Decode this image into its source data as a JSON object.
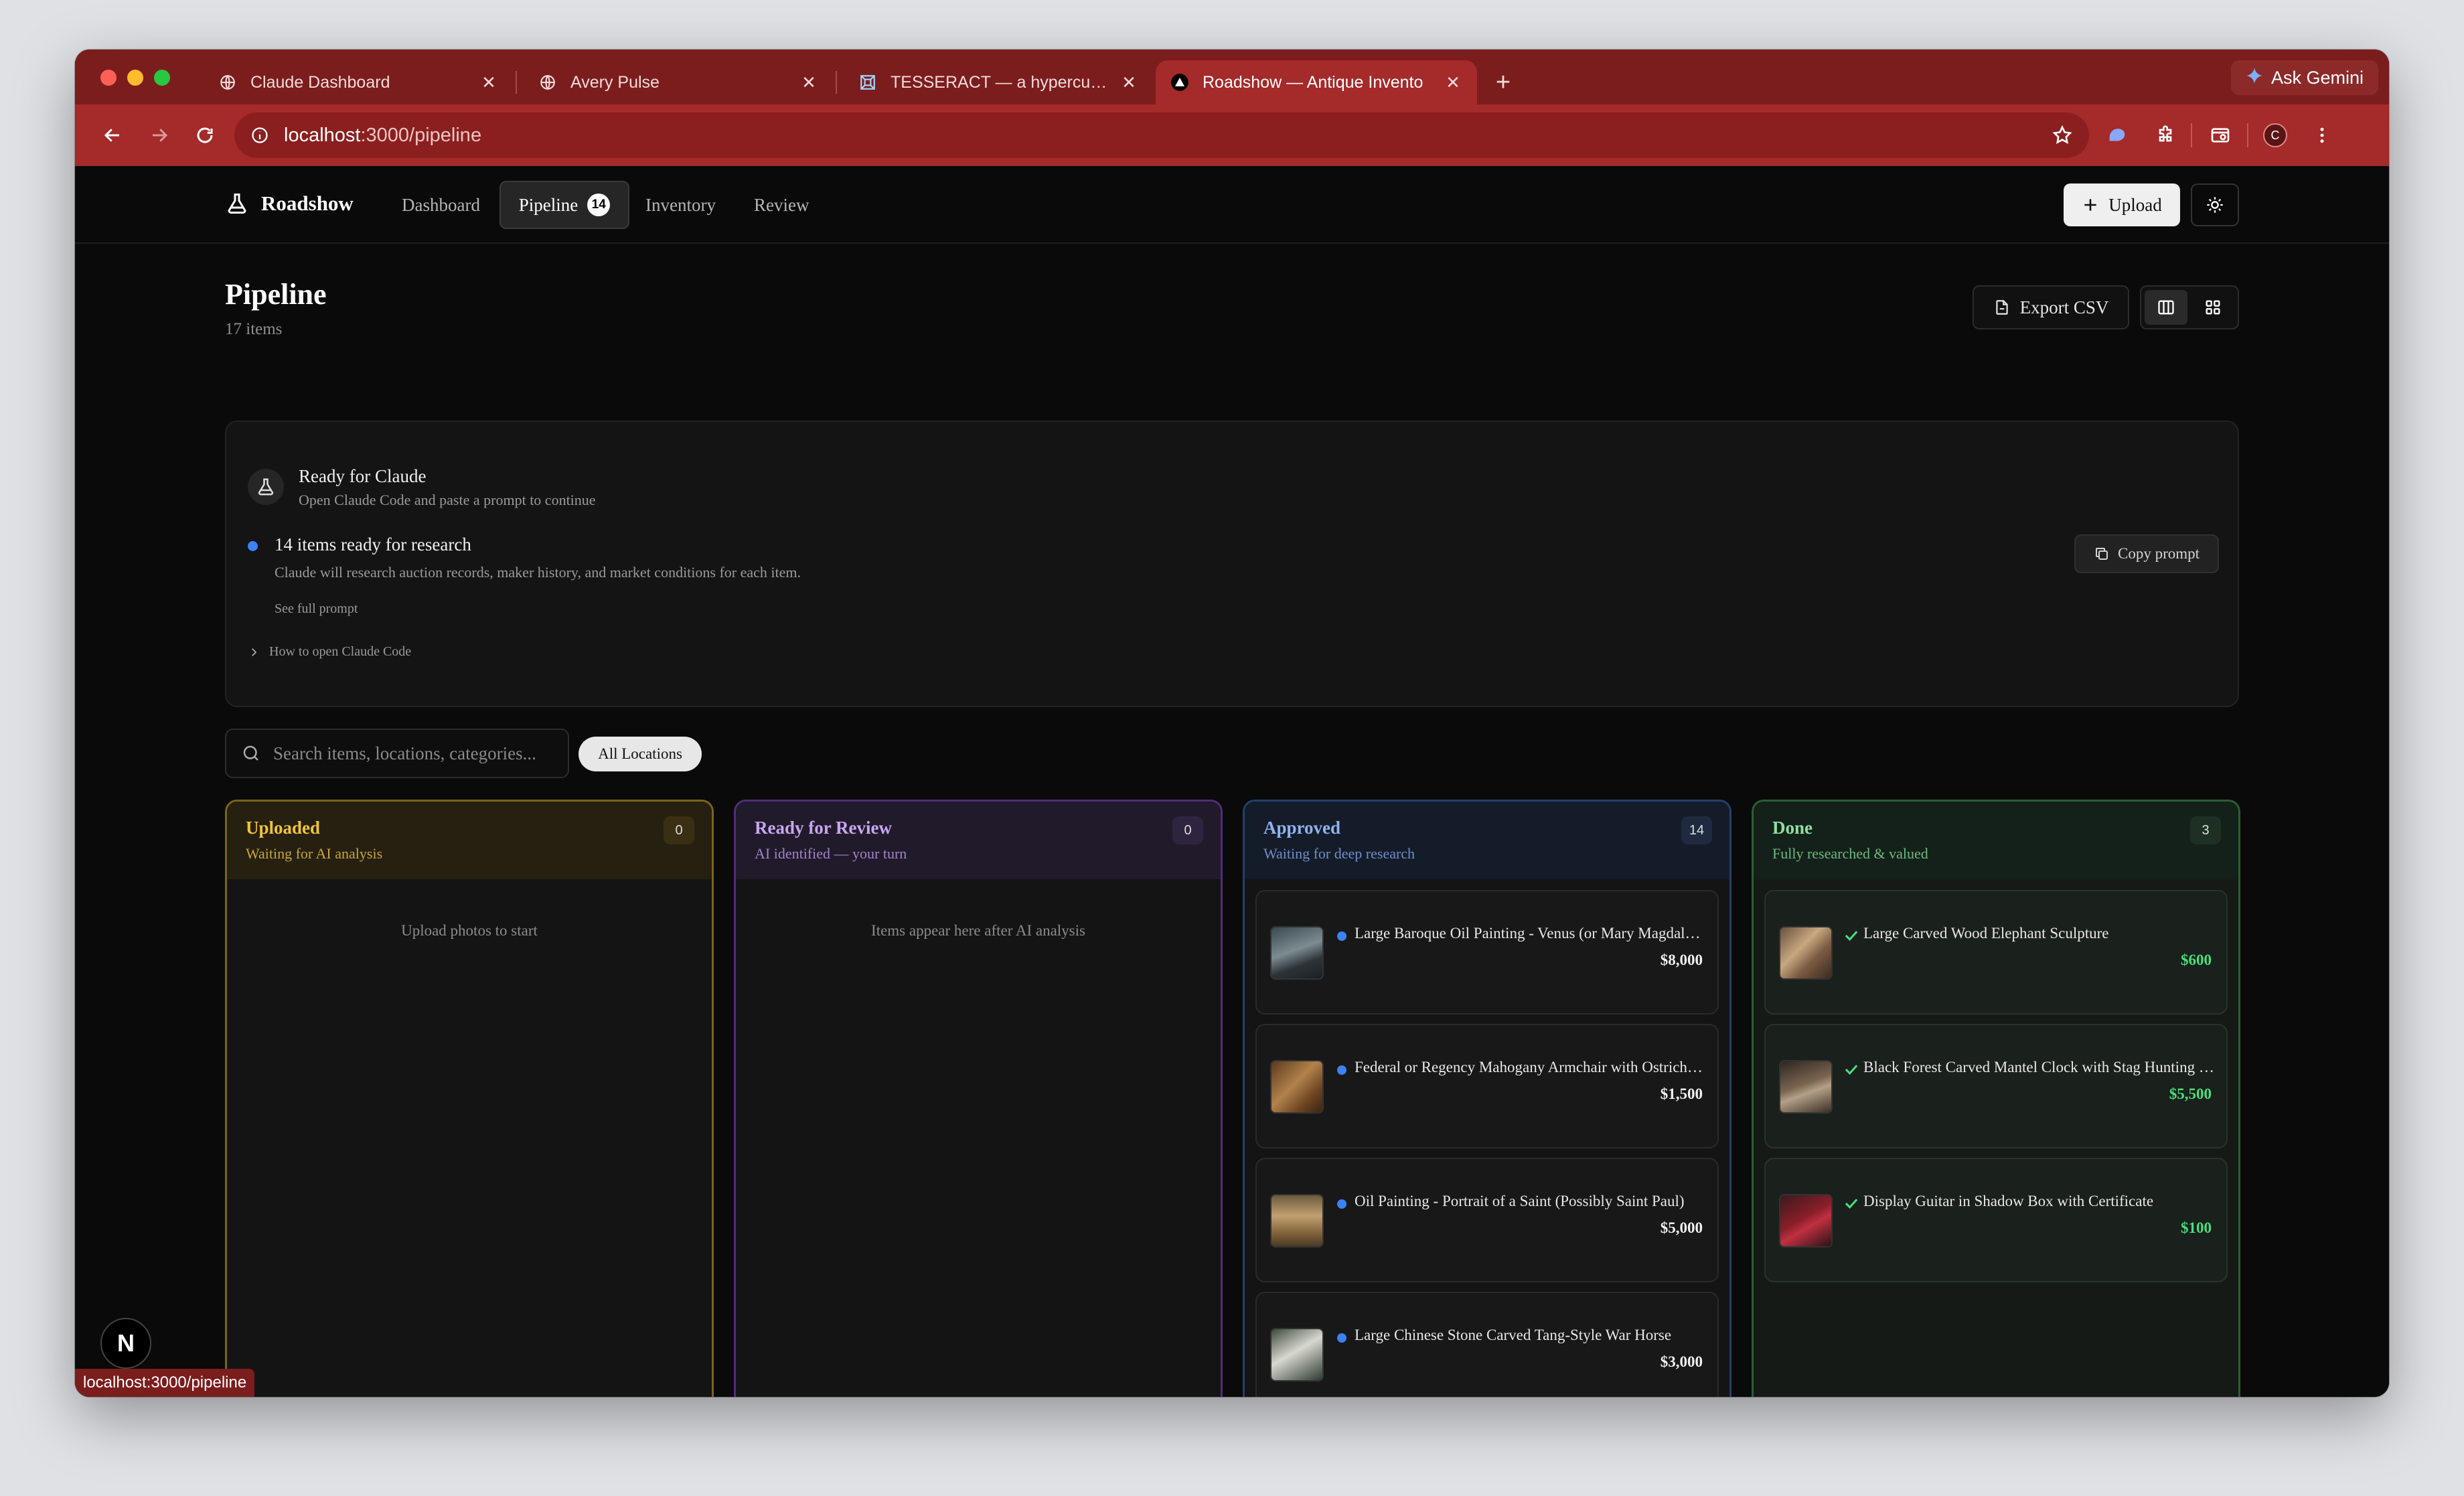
{
  "browser": {
    "tabs": [
      {
        "title": "Claude Dashboard",
        "active": false
      },
      {
        "title": "Avery Pulse",
        "active": false
      },
      {
        "title": "TESSERACT — a hypercube y",
        "active": false
      },
      {
        "title": "Roadshow — Antique Invento",
        "active": true
      }
    ],
    "gemini_label": "Ask Gemini",
    "url_host": "localhost",
    "url_path": ":3000/pipeline",
    "avatar_letter": "C",
    "status_url": "localhost:3000/pipeline",
    "accent": "#a52a2a"
  },
  "app": {
    "brand": "Roadshow",
    "nav": {
      "dashboard": "Dashboard",
      "pipeline": "Pipeline",
      "pipeline_badge": "14",
      "inventory": "Inventory",
      "review": "Review"
    },
    "upload_label": "Upload"
  },
  "page": {
    "title": "Pipeline",
    "count": "17 items",
    "export_label": "Export CSV"
  },
  "claude_card": {
    "title": "Ready for Claude",
    "subtitle": "Open Claude Code and paste a prompt to continue",
    "ready_text": "14 items ready for research",
    "description": "Claude will research auction records, maker history, and market conditions for each item.",
    "see_full": "See full prompt",
    "how_to": "How to open Claude Code",
    "copy_label": "Copy prompt"
  },
  "filters": {
    "search_placeholder": "Search items, locations, categories...",
    "location_chip": "All Locations"
  },
  "columns": {
    "uploaded": {
      "title": "Uploaded",
      "subtitle": "Waiting for AI analysis",
      "count": "0",
      "empty": "Upload photos to start",
      "color": "#a8861d"
    },
    "review": {
      "title": "Ready for Review",
      "subtitle": "AI identified — your turn",
      "count": "0",
      "empty": "Items appear here after AI analysis",
      "color": "#6b3fa0"
    },
    "approved": {
      "title": "Approved",
      "subtitle": "Waiting for deep research",
      "count": "14",
      "color": "#2f4f86",
      "items": [
        {
          "name": "Large Baroque Oil Painting - Venus (or Mary Magdalene)",
          "price": "$8,000"
        },
        {
          "name": "Federal or Regency Mahogany Armchair with Ostrich Upholstery",
          "price": "$1,500"
        },
        {
          "name": "Oil Painting - Portrait of a Saint (Possibly Saint Paul)",
          "price": "$5,000"
        },
        {
          "name": "Large Chinese Stone Carved Tang-Style War Horse",
          "price": "$3,000"
        }
      ]
    },
    "done": {
      "title": "Done",
      "subtitle": "Fully researched & valued",
      "count": "3",
      "color": "#2f7a3f",
      "items": [
        {
          "name": "Large Carved Wood Elephant Sculpture",
          "price": "$600"
        },
        {
          "name": "Black Forest Carved Mantel Clock with Stag Hunting Scene",
          "price": "$5,500"
        },
        {
          "name": "Display Guitar in Shadow Box with Certificate",
          "price": "$100"
        }
      ]
    }
  },
  "dev_badge_letter": "N"
}
